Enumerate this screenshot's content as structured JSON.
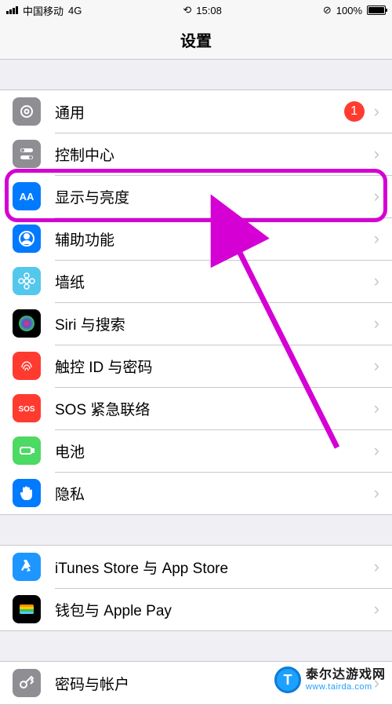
{
  "status": {
    "carrier": "中国移动",
    "network": "4G",
    "time": "15:08",
    "battery_pct": "100%"
  },
  "nav": {
    "title": "设置"
  },
  "groups": [
    {
      "rows": [
        {
          "key": "general",
          "label": "通用",
          "icon": "gear",
          "bg": "#8e8e93",
          "badge": "1"
        },
        {
          "key": "control",
          "label": "控制中心",
          "icon": "toggles",
          "bg": "#8e8e93"
        },
        {
          "key": "display",
          "label": "显示与亮度",
          "icon": "aa",
          "bg": "#007aff",
          "highlight": true
        },
        {
          "key": "access",
          "label": "辅助功能",
          "icon": "person",
          "bg": "#007aff"
        },
        {
          "key": "wall",
          "label": "墙纸",
          "icon": "flower",
          "bg": "#54c7ec"
        },
        {
          "key": "siri",
          "label": "Siri 与搜索",
          "icon": "siri",
          "bg": "#000"
        },
        {
          "key": "touchid",
          "label": "触控 ID 与密码",
          "icon": "finger",
          "bg": "#ff3b30"
        },
        {
          "key": "sos",
          "label": "SOS 紧急联络",
          "icon": "sos",
          "bg": "#ff3b30"
        },
        {
          "key": "battery",
          "label": "电池",
          "icon": "battery",
          "bg": "#4cd964"
        },
        {
          "key": "privacy",
          "label": "隐私",
          "icon": "hand",
          "bg": "#007aff"
        }
      ]
    },
    {
      "rows": [
        {
          "key": "itunes",
          "label": "iTunes Store 与 App Store",
          "icon": "appstore",
          "bg": "#1e96ff"
        },
        {
          "key": "wallet",
          "label": "钱包与 Apple Pay",
          "icon": "wallet",
          "bg": "#000"
        }
      ]
    },
    {
      "rows": [
        {
          "key": "accounts",
          "label": "密码与帐户",
          "icon": "key",
          "bg": "#8e8e93"
        }
      ]
    }
  ],
  "watermark": {
    "title": "泰尔达游戏网",
    "url": "www.tairda.com"
  },
  "icons": {
    "gear": "<svg viewBox='0 0 24 24' fill='none' stroke='#fff' stroke-width='2'><circle cx='12' cy='12' r='7'/><circle cx='12' cy='12' r='2.5'/></svg>",
    "toggles": "<svg viewBox='0 0 24 24' fill='#fff'><rect x='4' y='5' width='16' height='5' rx='2.5'/><rect x='4' y='14' width='16' height='5' rx='2.5'/><circle cx='7' cy='7.5' r='2' fill='#8e8e93'/><circle cx='17' cy='16.5' r='2' fill='#8e8e93'/></svg>",
    "aa": "<svg viewBox='0 0 24 24' fill='#fff'><text x='12' y='17' text-anchor='middle' font-size='13' font-weight='600' font-family='Helvetica'>AA</text></svg>",
    "person": "<svg viewBox='0 0 24 24' fill='none' stroke='#fff' stroke-width='2'><circle cx='12' cy='12' r='9'/><circle cx='12' cy='9' r='3' fill='#fff'/><path d='M6 19c1-3 4-4 6-4s5 1 6 4' fill='#fff'/></svg>",
    "flower": "<svg viewBox='0 0 24 24' fill='none' stroke='#fff' stroke-width='1.5'><circle cx='12' cy='12' r='3'/><circle cx='12' cy='5' r='3'/><circle cx='12' cy='19' r='3'/><circle cx='5' cy='12' r='3'/><circle cx='19' cy='12' r='3'/></svg>",
    "siri": "<svg viewBox='0 0 24 24'><defs><radialGradient id='sg'><stop offset='0%' stop-color='#ff2d55'/><stop offset='50%' stop-color='#5856d6'/><stop offset='100%' stop-color='#34c759'/></radialGradient></defs><circle cx='12' cy='12' r='10' fill='url(#sg)'/></svg>",
    "finger": "<svg viewBox='0 0 24 24' fill='none' stroke='#fff' stroke-width='1.3'><path d='M6 14c0-4 3-7 6-7s6 3 6 7'/><path d='M8 16c0-3 2-5 4-5s4 2 4 5'/><path d='M10 18c0-2 1-3 2-3s2 1 2 3'/></svg>",
    "sos": "<svg viewBox='0 0 24 24' fill='#fff'><text x='12' y='16' text-anchor='middle' font-size='10' font-weight='700' font-family='Helvetica'>SOS</text></svg>",
    "battery": "<svg viewBox='0 0 24 24' fill='none' stroke='#fff' stroke-width='2'><rect x='4' y='8' width='14' height='8' rx='2'/><rect x='19' y='10' width='2' height='4' fill='#fff'/></svg>",
    "hand": "<svg viewBox='0 0 24 24' fill='#fff'><path d='M7 12V6a1.5 1.5 0 013 0v5V5a1.5 1.5 0 013 0v6V6a1.5 1.5 0 013 0v6V9a1.5 1.5 0 013 0v6c0 3-2 6-6 6h-2c-3 0-5-2-6-5l-1-3a1.5 1.5 0 013-1z'/></svg>",
    "appstore": "<svg viewBox='0 0 24 24' fill='#fff'><path d='M12 3l5 9h-3l3 5-5 1 2-4H9l2-4-4 7-2-1 5-9-2-3 2-1z'/></svg>",
    "wallet": "<svg viewBox='0 0 24 24'><rect x='3' y='6' width='18' height='12' rx='2' fill='#333'/><rect x='3' y='6' width='18' height='4' rx='2' fill='#ff9500'/><rect x='3' y='9' width='18' height='4' fill='#ffcc00'/><rect x='3' y='12' width='18' height='4' fill='#34c759'/><rect x='3' y='15' width='18' height='3' rx='2' fill='#5ac8fa'/></svg>",
    "key": "<svg viewBox='0 0 24 24' fill='none' stroke='#fff' stroke-width='2'><circle cx='8' cy='14' r='4'/><path d='M11 11l7-7 2 2-2 2 2 2-3 3'/></svg>"
  }
}
